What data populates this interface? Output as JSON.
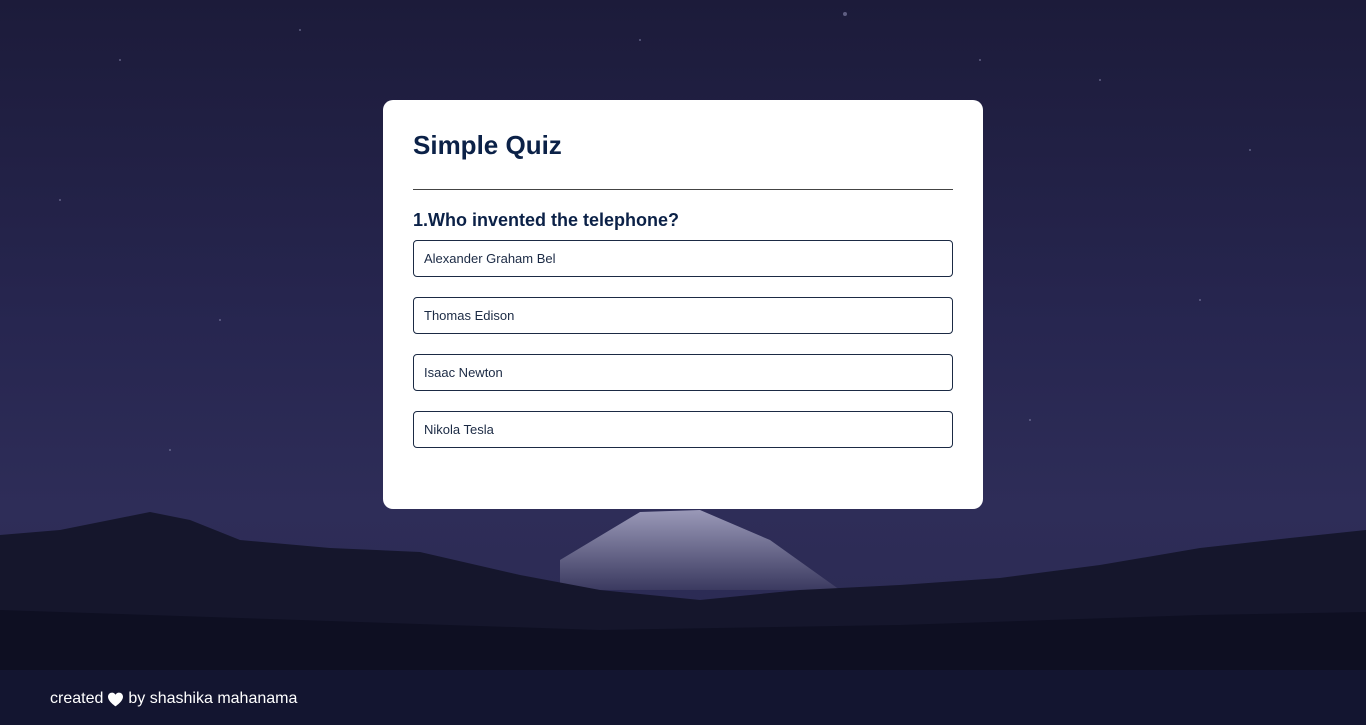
{
  "quiz": {
    "title": "Simple Quiz",
    "question": "1.Who invented the telephone?",
    "answers": [
      "Alexander Graham Bel",
      "Thomas Edison",
      "Isaac Newton",
      "Nikola Tesla"
    ]
  },
  "footer": {
    "prefix": "created",
    "icon": "heart-icon",
    "suffix": "by shashika mahanama"
  },
  "colors": {
    "title": "#0b2147",
    "card": "#ffffff",
    "sky": "#24234a",
    "footer_text": "#ffffff"
  }
}
